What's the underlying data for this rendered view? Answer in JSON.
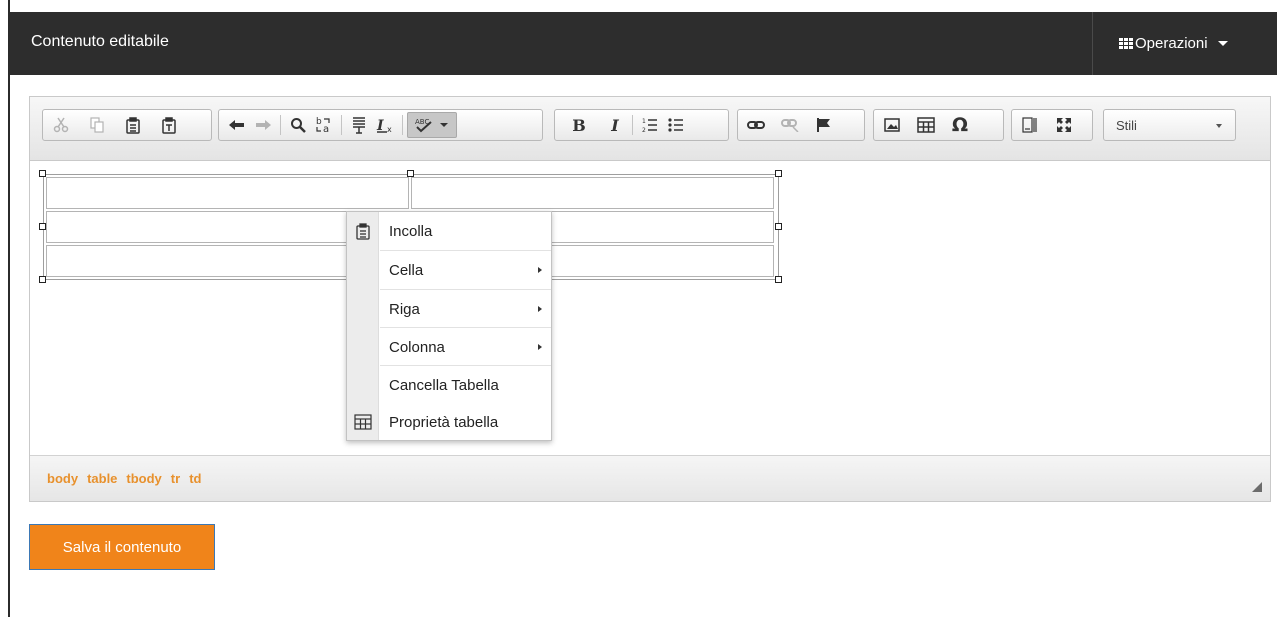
{
  "header": {
    "title": "Contenuto editabile",
    "operations_label": "Operazioni"
  },
  "toolbar": {
    "groups": [
      [
        "cut-icon",
        "copy-icon",
        "paste-icon",
        "paste-text-icon"
      ],
      [
        "undo-icon",
        "redo-icon",
        "find-icon",
        "replace-icon",
        "select-all-icon",
        "remove-format-icon",
        "spellcheck-icon"
      ],
      [
        "bold-icon",
        "italic-icon",
        "numbered-list-icon",
        "bulleted-list-icon"
      ],
      [
        "link-icon",
        "unlink-icon",
        "anchor-icon"
      ],
      [
        "image-icon",
        "table-icon",
        "special-char-icon"
      ],
      [
        "show-blocks-icon",
        "maximize-icon"
      ]
    ],
    "styles_label": "Stili",
    "bold_glyph": "B",
    "italic_glyph": "I",
    "omega_glyph": "Ω"
  },
  "context_menu": {
    "items": [
      {
        "label": "Incolla",
        "icon": "paste-icon",
        "submenu": false
      },
      {
        "label": "Cella",
        "icon": "",
        "submenu": true
      },
      {
        "label": "Riga",
        "icon": "",
        "submenu": true
      },
      {
        "label": "Colonna",
        "icon": "",
        "submenu": true
      },
      {
        "label": "Cancella Tabella",
        "icon": "",
        "submenu": false
      },
      {
        "label": "Proprietà tabella",
        "icon": "table-icon",
        "submenu": false
      }
    ]
  },
  "statusbar": {
    "path": [
      "body",
      "table",
      "tbody",
      "tr",
      "td"
    ]
  },
  "save_button": "Salva il contenuto",
  "colors": {
    "header_bg": "#2d2d2d",
    "accent_orange": "#f0841a",
    "path_orange": "#e8912d"
  }
}
